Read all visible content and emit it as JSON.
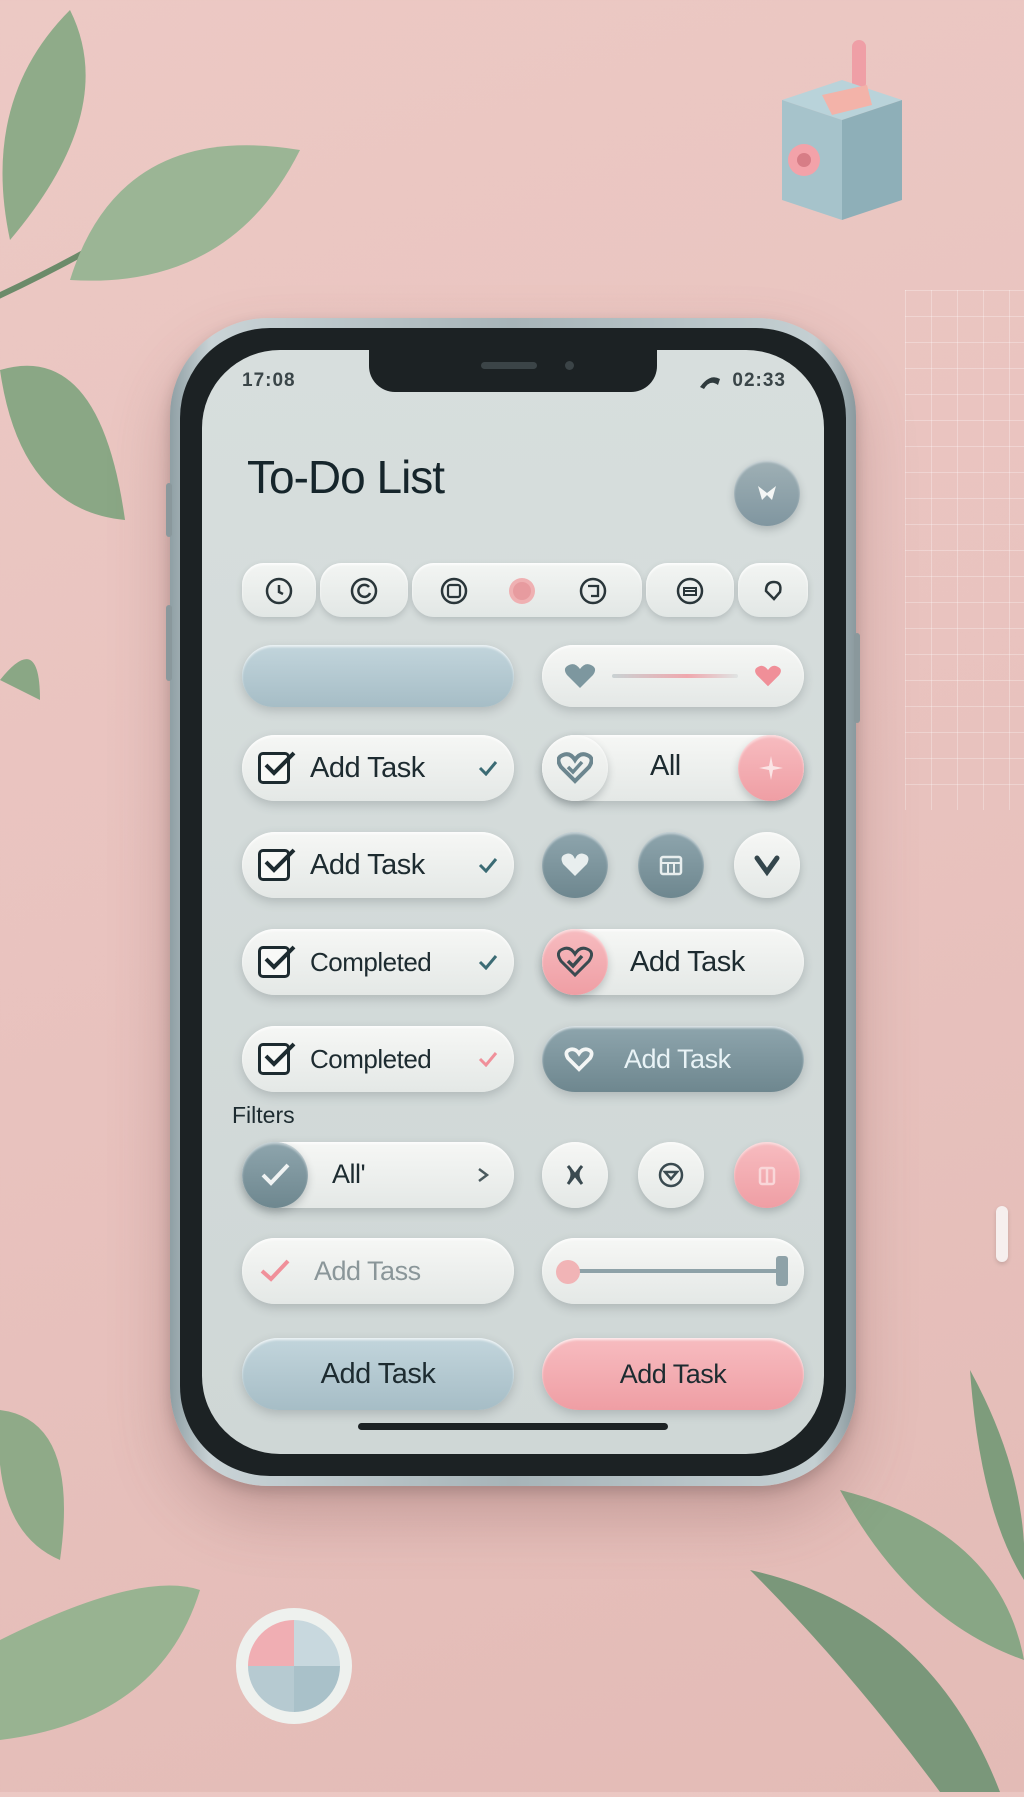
{
  "status_bar": {
    "time": "17:08",
    "battery": "02:33"
  },
  "header": {
    "title": "To-Do List",
    "subtitle": ""
  },
  "tasks": [
    {
      "label": "Add Task",
      "checked": true
    },
    {
      "label": "Add Task",
      "checked": true
    },
    {
      "label": "Completed",
      "checked": true
    },
    {
      "label": "Completed",
      "checked": true
    }
  ],
  "controls": {
    "filter_all_pill": "All",
    "add_task_right": "Add Task",
    "add_task_slate": "Add Task"
  },
  "filters": {
    "heading": "Filters",
    "all_select": "All'",
    "add_task_faded": "Add Tass"
  },
  "actions": {
    "add_task_blue": "Add Task",
    "add_task_pink": "Add Task"
  },
  "icons": {
    "toolbar": [
      "clock-icon",
      "refresh-icon",
      "calendar-icon",
      "heart-icon",
      "tag-icon",
      "inbox-icon",
      "bell-icon"
    ],
    "header_action": "share-icon"
  },
  "colors": {
    "background": "#e9c3bf",
    "screen": "#d3dbda",
    "pastel_blue": "#b2c8d0",
    "slate": "#7b939b",
    "pink": "#f2a6ab",
    "text": "#1d2b30"
  }
}
